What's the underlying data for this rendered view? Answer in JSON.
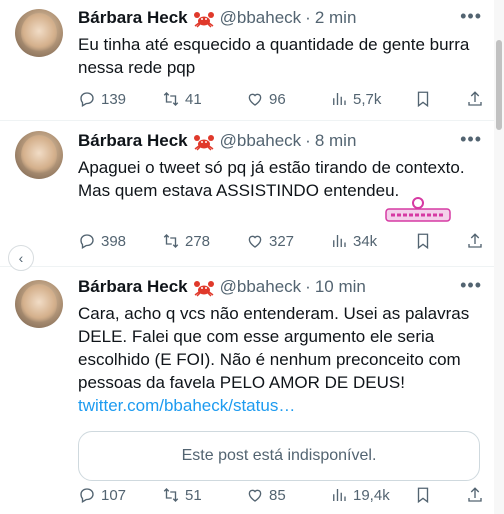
{
  "author": {
    "name": "Bárbara Heck",
    "handle": "@bbaheck",
    "separator": "·",
    "more": "•••"
  },
  "tweets": [
    {
      "time": "2 min",
      "text": "Eu tinha até esquecido a quantidade de gente burra nessa rede pqp",
      "stats": {
        "replies": "139",
        "retweets": "41",
        "likes": "96",
        "views": "5,7k"
      }
    },
    {
      "time": "8 min",
      "text": "Apaguei o tweet só pq já estão tirando de contexto. Mas quem estava ASSISTINDO entendeu.",
      "stats": {
        "replies": "398",
        "retweets": "278",
        "likes": "327",
        "views": "34k"
      }
    },
    {
      "time": "10 min",
      "text": "Cara, acho q vcs não entenderam. Usei as palavras DELE. Falei que com esse argumento ele seria escolhido (E FOI). Não é nenhum preconceito com pessoas da favela PELO AMOR DE DEUS!",
      "link": "twitter.com/bbaheck/status…",
      "quote_unavailable": "Este post está indisponível.",
      "stats": {
        "replies": "107",
        "retweets": "51",
        "likes": "85",
        "views": "19,4k"
      }
    }
  ],
  "colors": {
    "text": "#0f1419",
    "secondary": "#536471",
    "link": "#1d9bf0",
    "crab": "#e0392b",
    "watermark": "#d63aa3"
  },
  "icons": [
    "reply-icon",
    "retweet-icon",
    "like-icon",
    "views-icon",
    "bookmark-icon",
    "share-icon",
    "crab-emoji",
    "more-icon",
    "back-arrow-icon"
  ]
}
